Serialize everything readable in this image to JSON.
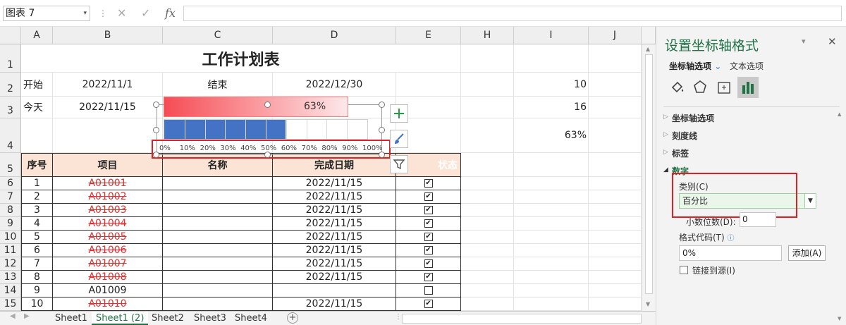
{
  "formula_bar": {
    "name_box": "图表 7",
    "formula": ""
  },
  "columns": [
    "A",
    "B",
    "C",
    "D",
    "E",
    "H",
    "I",
    "J"
  ],
  "rows": [
    "1",
    "2",
    "3",
    "4",
    "5",
    "6",
    "7",
    "8",
    "9",
    "10",
    "11",
    "12",
    "13",
    "14",
    "15"
  ],
  "sheet": {
    "title": "工作计划表",
    "start_label": "开始",
    "start_date": "2022/11/1",
    "end_label": "结束",
    "end_date": "2022/12/30",
    "today_label": "今天",
    "today_date": "2022/11/15",
    "i2": "10",
    "i3": "16",
    "i4": "63%",
    "headers": [
      "序号",
      "项目",
      "名称",
      "完成日期",
      "状态"
    ],
    "tasks": [
      {
        "no": "1",
        "item": "A01001",
        "date": "2022/11/15",
        "checked": true,
        "done": true
      },
      {
        "no": "2",
        "item": "A01002",
        "date": "2022/11/15",
        "checked": true,
        "done": true
      },
      {
        "no": "3",
        "item": "A01003",
        "date": "2022/11/15",
        "checked": true,
        "done": true
      },
      {
        "no": "4",
        "item": "A01004",
        "date": "2022/11/15",
        "checked": true,
        "done": true
      },
      {
        "no": "5",
        "item": "A01005",
        "date": "2022/11/15",
        "checked": true,
        "done": true
      },
      {
        "no": "6",
        "item": "A01006",
        "date": "2022/11/15",
        "checked": true,
        "done": true
      },
      {
        "no": "7",
        "item": "A01007",
        "date": "2022/11/15",
        "checked": true,
        "done": true
      },
      {
        "no": "8",
        "item": "A01008",
        "date": "2022/11/15",
        "checked": true,
        "done": true
      },
      {
        "no": "9",
        "item": "A01009",
        "date": "",
        "checked": false,
        "done": false
      },
      {
        "no": "10",
        "item": "A01010",
        "date": "2022/11/15",
        "checked": true,
        "done": true
      }
    ]
  },
  "progress": {
    "label": "63%",
    "fraction": 0.63
  },
  "chart_axis": {
    "ticks": [
      "0%",
      "10%",
      "20%",
      "30%",
      "40%",
      "50%",
      "60%",
      "70%",
      "80%",
      "90%",
      "100%"
    ]
  },
  "chart_tools": [
    "plus-icon",
    "brush-icon",
    "filter-icon"
  ],
  "sheet_tabs": [
    "Sheet1",
    "Sheet1 (2)",
    "Sheet2",
    "Sheet3",
    "Sheet4"
  ],
  "active_tab": 1,
  "pane": {
    "title": "设置坐标轴格式",
    "tab_axis": "坐标轴选项",
    "tab_text": "文本选项",
    "sections": [
      "坐标轴选项",
      "刻度线",
      "标签",
      "数字"
    ],
    "category_label": "类别(C)",
    "category_value": "百分比",
    "decimal_label": "小数位数(D):",
    "decimal_value": "0",
    "format_code_label": "格式代码(T)",
    "format_code_value": "0%",
    "add_button": "添加(A)",
    "link_source": "链接到源(I)"
  },
  "colors": {
    "accent": "#217346",
    "highlight": "#e02020",
    "bar_blue": "#4472c4",
    "header_fill": "#fbe4d5"
  }
}
